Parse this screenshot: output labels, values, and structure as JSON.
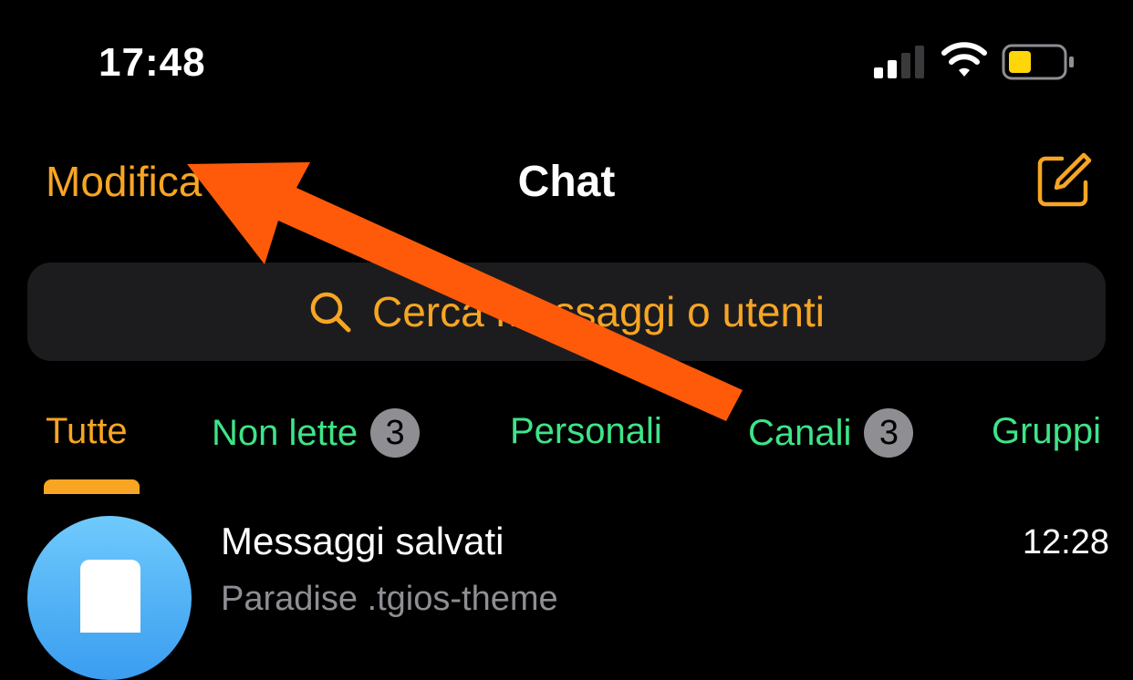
{
  "status_bar": {
    "time": "17:48",
    "signal_icon": "cellular-signal-icon",
    "wifi_icon": "wifi-icon",
    "battery_icon": "battery-icon",
    "battery_color": "#ffd60a"
  },
  "nav": {
    "edit_label": "Modifica",
    "title": "Chat",
    "compose_icon": "compose-icon"
  },
  "search": {
    "placeholder": "Cerca messaggi o utenti",
    "icon": "search-icon"
  },
  "tabs": [
    {
      "label": "Tutte",
      "active": true
    },
    {
      "label": "Non lette",
      "badge": "3"
    },
    {
      "label": "Personali"
    },
    {
      "label": "Canali",
      "badge": "3"
    },
    {
      "label": "Gruppi"
    }
  ],
  "chats": [
    {
      "name": "Messaggi salvati",
      "time": "12:28",
      "preview": "Paradise .tgios-theme",
      "avatar_icon": "bookmark-icon"
    }
  ],
  "colors": {
    "accent": "#f7a523",
    "tab_green": "#3ee488",
    "arrow": "#ff5a0a",
    "background": "#000000"
  }
}
